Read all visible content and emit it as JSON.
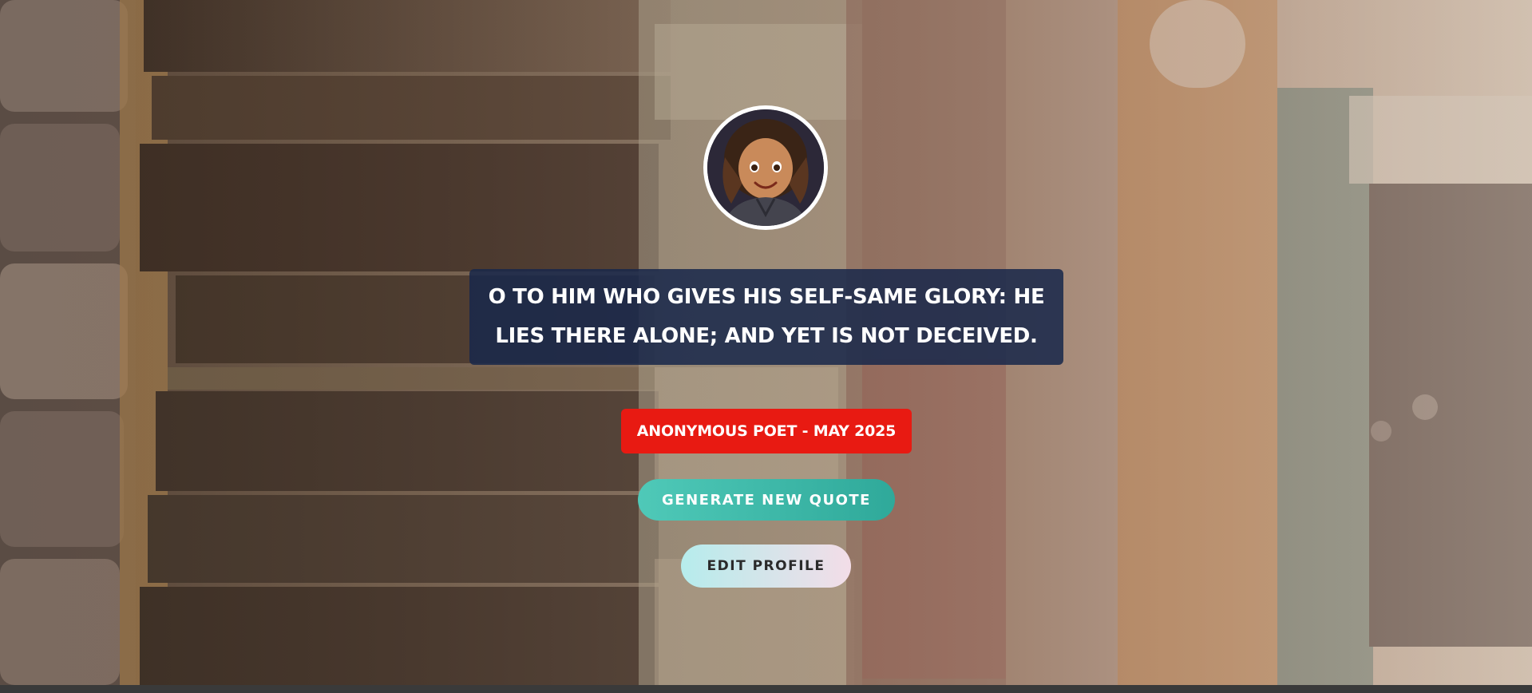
{
  "profile": {
    "avatar_icon": "girl-avatar-icon"
  },
  "quote": {
    "line1": "O TO HIM WHO GIVES HIS SELF-SAME GLORY: HE",
    "line2": "LIES THERE ALONE; AND YET IS NOT DECEIVED."
  },
  "author": {
    "label": "ANONYMOUS POET - MAY 2025"
  },
  "actions": {
    "generate_label": "GENERATE NEW QUOTE",
    "edit_label": "EDIT PROFILE"
  },
  "colors": {
    "quote_bg": "#19284B",
    "author_badge": "#E81A12",
    "generate_button": "#3DB8A8",
    "edit_button_start": "#B6ECEC",
    "edit_button_end": "#F3DDE8"
  }
}
